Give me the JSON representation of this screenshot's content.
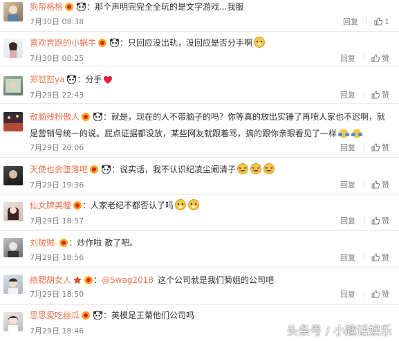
{
  "comments": [
    {
      "user": "狗带格格",
      "text": "那个声明完完全全玩的是文字游戏...我服",
      "time": "7月30日 08:38",
      "reply": "回复",
      "like": "1",
      "emojis": []
    },
    {
      "user": "喜欢奔跑的小蜗牛",
      "text": "只回应没出轨，没回应是否分手啊",
      "time": "7月30日 00:25",
      "reply": "回复",
      "like": "赞",
      "emojis": [
        "doge"
      ]
    },
    {
      "user": "郑怼怼ya",
      "text": "分手",
      "time": "7月29日 22:43",
      "reply": "回复",
      "like": "赞",
      "emojis": [
        "heart"
      ]
    },
    {
      "user": "敖脑残粉傲人",
      "text": "就是，现在的人不带脑子的吗？你等真的放出实锤了再喷人家也不迟啊，就是营销号统一的说。屁点证据都没放，某些网友就跟着骂，搞的跟你亲眼看见了一样",
      "time": "7月29日 20:06",
      "reply": "回复",
      "like": "赞",
      "emojis": [
        "facepalm",
        "facepalm"
      ]
    },
    {
      "user": "天使也会堕落吧",
      "text": "说实话，我不认识纪凌尘阚清子",
      "time": "7月29日 19:36",
      "reply": "回复",
      "like": "赞",
      "emojis": [
        "laugh",
        "laugh",
        "laugh"
      ]
    },
    {
      "user": "仙女牌美瞳",
      "text": "人家老纪不都否认了吗",
      "time": "7月29日 18:57",
      "reply": "回复",
      "like": "赞",
      "emojis": [
        "doge",
        "doge"
      ]
    },
    {
      "user": "刘贼贼-",
      "text": "炒作啦 散了吧。",
      "time": "7月29日 18:56",
      "reply": "回复",
      "like": "赞",
      "emojis": []
    },
    {
      "user": "络腮胡女人",
      "mention": "@Swag2018",
      "text": "这个公司就是我们菊姐的公司吧",
      "time": "7月29日 18:50",
      "reply": "回复",
      "like": "赞",
      "emojis": []
    },
    {
      "user": "思思爱吃丝瓜",
      "text": "英模是王菊他们公司吗",
      "time": "7月29日 18:46",
      "reply": "回复",
      "like": "赞",
      "emojis": []
    }
  ],
  "colors": {
    "username": "#eb7350",
    "text": "#333333",
    "meta": "#808080"
  },
  "watermark": "头条号 / 小趣话娱乐"
}
